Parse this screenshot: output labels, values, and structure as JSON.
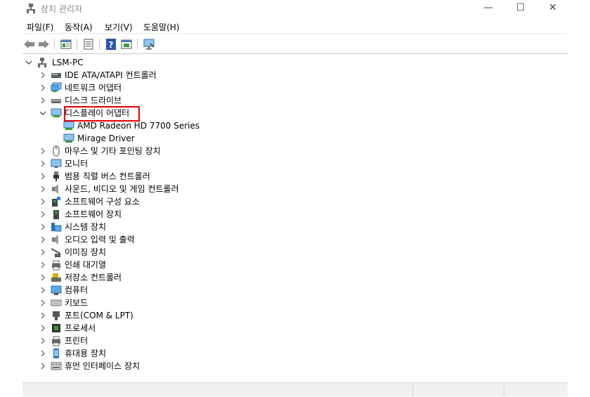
{
  "window": {
    "title": "장치 관리자",
    "minimize": "—",
    "maximize": "☐",
    "close": "✕"
  },
  "menu": [
    "파일(F)",
    "동작(A)",
    "보기(V)",
    "도움말(H)"
  ],
  "toolbar": [
    "back-arrow-icon",
    "forward-arrow-icon",
    "properties-panel-icon",
    "list-icon",
    "help-icon",
    "update-driver-icon",
    "monitor-scan-icon"
  ],
  "tree": {
    "root": "LSM-PC",
    "categories": [
      {
        "label": "IDE ATA/ATAPI 컨트롤러",
        "icon": "ide-controller-icon"
      },
      {
        "label": "네트워크 어댑터",
        "icon": "network-adapter-icon"
      },
      {
        "label": "디스크 드라이브",
        "icon": "disk-drive-icon"
      },
      {
        "label": "디스플레이 어댑터",
        "icon": "display-adapter-icon",
        "expanded": true,
        "children": [
          "AMD Radeon HD 7700 Series",
          "Mirage Driver"
        ]
      },
      {
        "label": "마우스 및 기타 포인팅 장치",
        "icon": "mouse-icon"
      },
      {
        "label": "모니터",
        "icon": "monitor-icon"
      },
      {
        "label": "범용 직렬 버스 컨트롤러",
        "icon": "usb-icon"
      },
      {
        "label": "사운드, 비디오 및 게임 컨트롤러",
        "icon": "speaker-icon"
      },
      {
        "label": "소프트웨어 구성 요소",
        "icon": "software-component-icon"
      },
      {
        "label": "소프트웨어 장치",
        "icon": "software-device-icon"
      },
      {
        "label": "시스템 장치",
        "icon": "system-device-icon"
      },
      {
        "label": "오디오 입력 및 출력",
        "icon": "audio-io-icon"
      },
      {
        "label": "이미징 장치",
        "icon": "imaging-device-icon"
      },
      {
        "label": "인쇄 대기열",
        "icon": "print-queue-icon"
      },
      {
        "label": "저장소 컨트롤러",
        "icon": "storage-controller-icon"
      },
      {
        "label": "컴퓨터",
        "icon": "computer-icon"
      },
      {
        "label": "키보드",
        "icon": "keyboard-icon"
      },
      {
        "label": "포트(COM & LPT)",
        "icon": "port-icon"
      },
      {
        "label": "프로세서",
        "icon": "processor-icon"
      },
      {
        "label": "프린터",
        "icon": "printer-icon"
      },
      {
        "label": "휴대용 장치",
        "icon": "portable-device-icon"
      },
      {
        "label": "휴먼 인터페이스 장치",
        "icon": "hid-icon"
      }
    ]
  },
  "colors": {
    "highlight": "#e00000",
    "iconBlue": "#2f7fd4",
    "iconGreen": "#3a9a3a"
  }
}
